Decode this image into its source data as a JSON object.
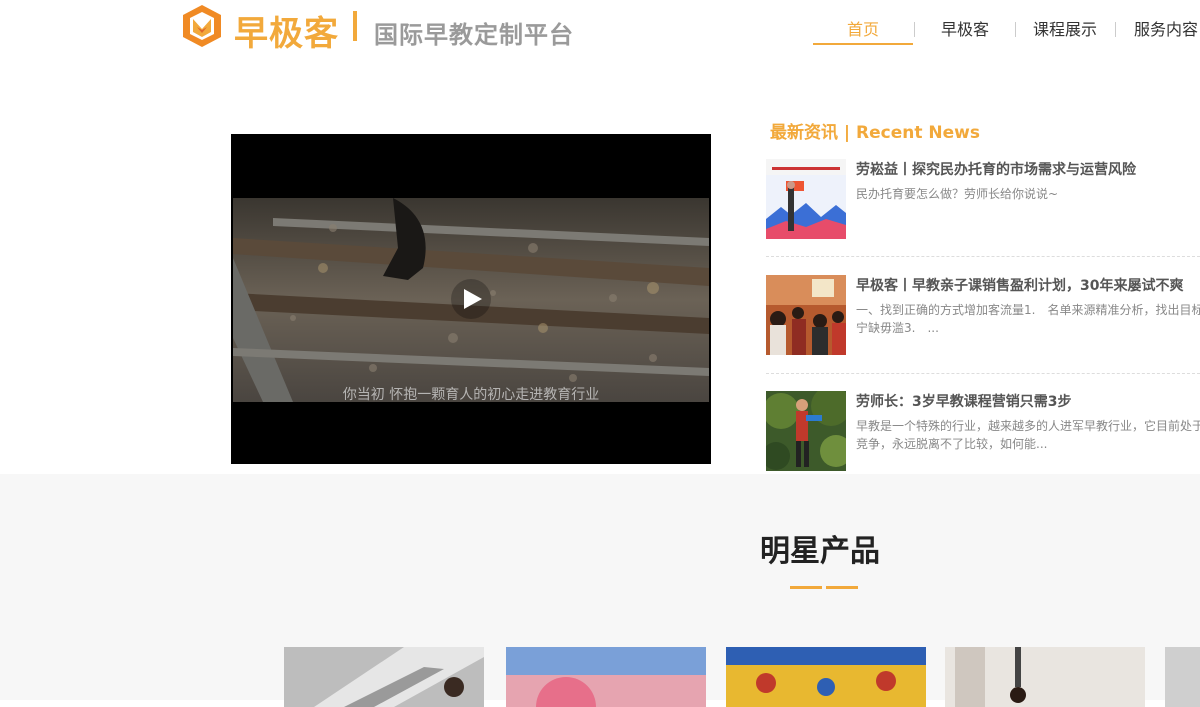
{
  "brand": {
    "name": "早极客",
    "separator": "|",
    "slogan": "国际早教定制平台"
  },
  "nav": [
    {
      "label": "首页",
      "active": true
    },
    {
      "label": "早极客",
      "active": false
    },
    {
      "label": "课程展示",
      "active": false
    },
    {
      "label": "服务内容",
      "active": false
    }
  ],
  "video": {
    "subtitle": "你当初 怀抱一颗育人的初心走进教育行业",
    "play_icon": "play-icon"
  },
  "news": {
    "title": "最新资讯 | Recent News",
    "items": [
      {
        "headline": "劳崧益丨探究民办托育的市场需求与运营风险",
        "desc": "民办托育要怎么做？劳师长给你说说~"
      },
      {
        "headline": "早极客丨早教亲子课销售盈利计划，30年来屡试不爽",
        "desc": "一、找到正确的方式增加客流量1.　名单来源精准分析，找出目标宁缺毋滥3.　..."
      },
      {
        "headline": "劳师长：3岁早教课程营销只需3步",
        "desc": "早教是一个特殊的行业，越来越多的人进军早教行业，它目前处于竞争，永远脱离不了比较，如何能..."
      }
    ]
  },
  "products": {
    "title": "明星产品"
  },
  "colors": {
    "accent": "#f2a93b",
    "muted": "#9a9a9a",
    "section_bg": "#f7f7f7"
  }
}
